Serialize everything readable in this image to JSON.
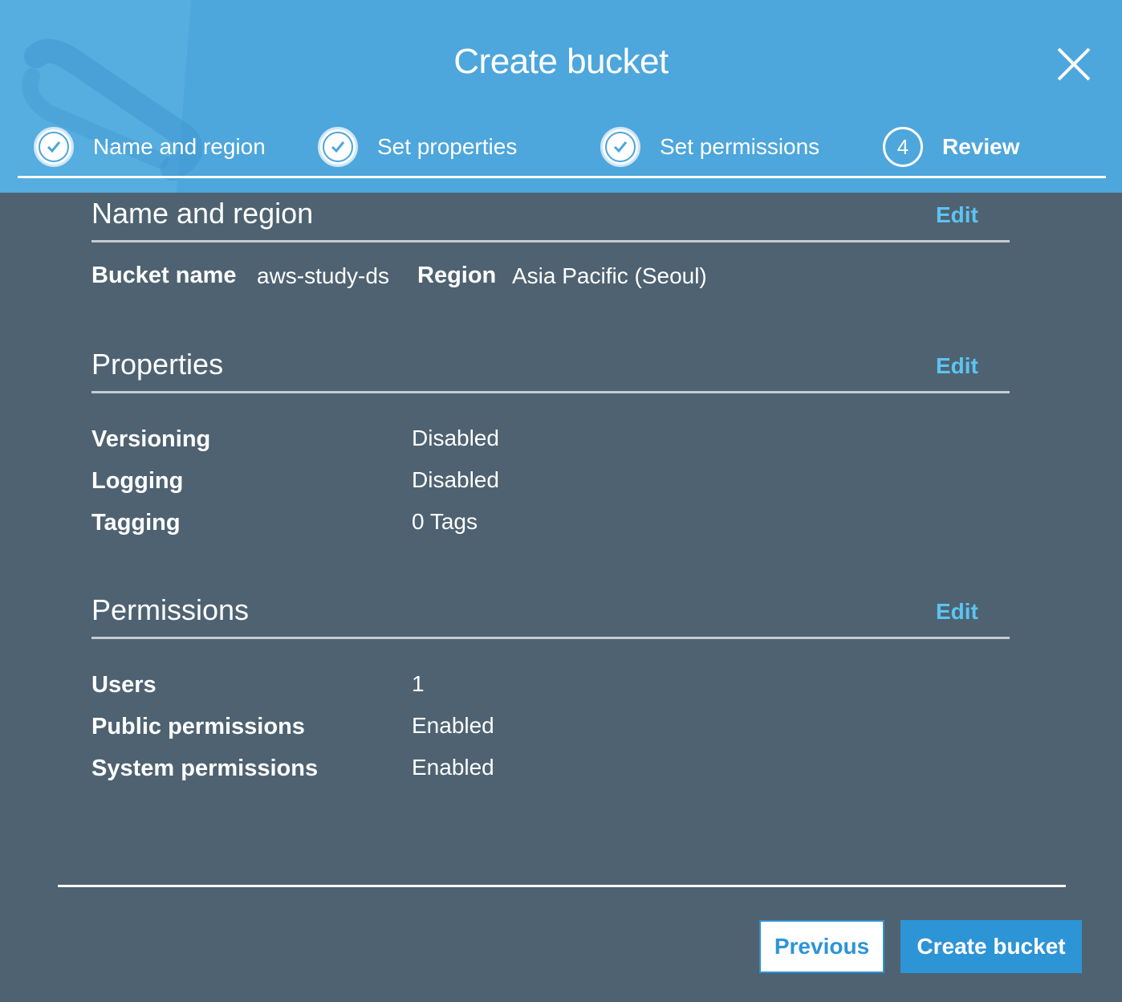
{
  "modal": {
    "title": "Create bucket",
    "close_icon": "close-icon"
  },
  "steps": [
    {
      "label": "Name and region",
      "state": "done",
      "icon": "check-icon"
    },
    {
      "label": "Set properties",
      "state": "done",
      "icon": "check-icon"
    },
    {
      "label": "Set permissions",
      "state": "done",
      "icon": "check-icon"
    },
    {
      "label": "Review",
      "state": "current",
      "number": "4"
    }
  ],
  "sections": {
    "name_region": {
      "title": "Name and region",
      "edit_label": "Edit",
      "bucket_name_label": "Bucket name",
      "bucket_name_value": "aws-study-ds",
      "region_label": "Region",
      "region_value": "Asia Pacific (Seoul)"
    },
    "properties": {
      "title": "Properties",
      "edit_label": "Edit",
      "rows": [
        {
          "label": "Versioning",
          "value": "Disabled"
        },
        {
          "label": "Logging",
          "value": "Disabled"
        },
        {
          "label": "Tagging",
          "value": "0 Tags"
        }
      ]
    },
    "permissions": {
      "title": "Permissions",
      "edit_label": "Edit",
      "rows": [
        {
          "label": "Users",
          "value": "1"
        },
        {
          "label": "Public permissions",
          "value": "Enabled"
        },
        {
          "label": "System permissions",
          "value": "Enabled"
        }
      ]
    }
  },
  "footer": {
    "previous_label": "Previous",
    "create_label": "Create bucket"
  },
  "colors": {
    "header_bg": "#4da6dc",
    "body_bg": "#4e6271",
    "link": "#5cc4f2",
    "primary_button": "#2d94d6"
  }
}
